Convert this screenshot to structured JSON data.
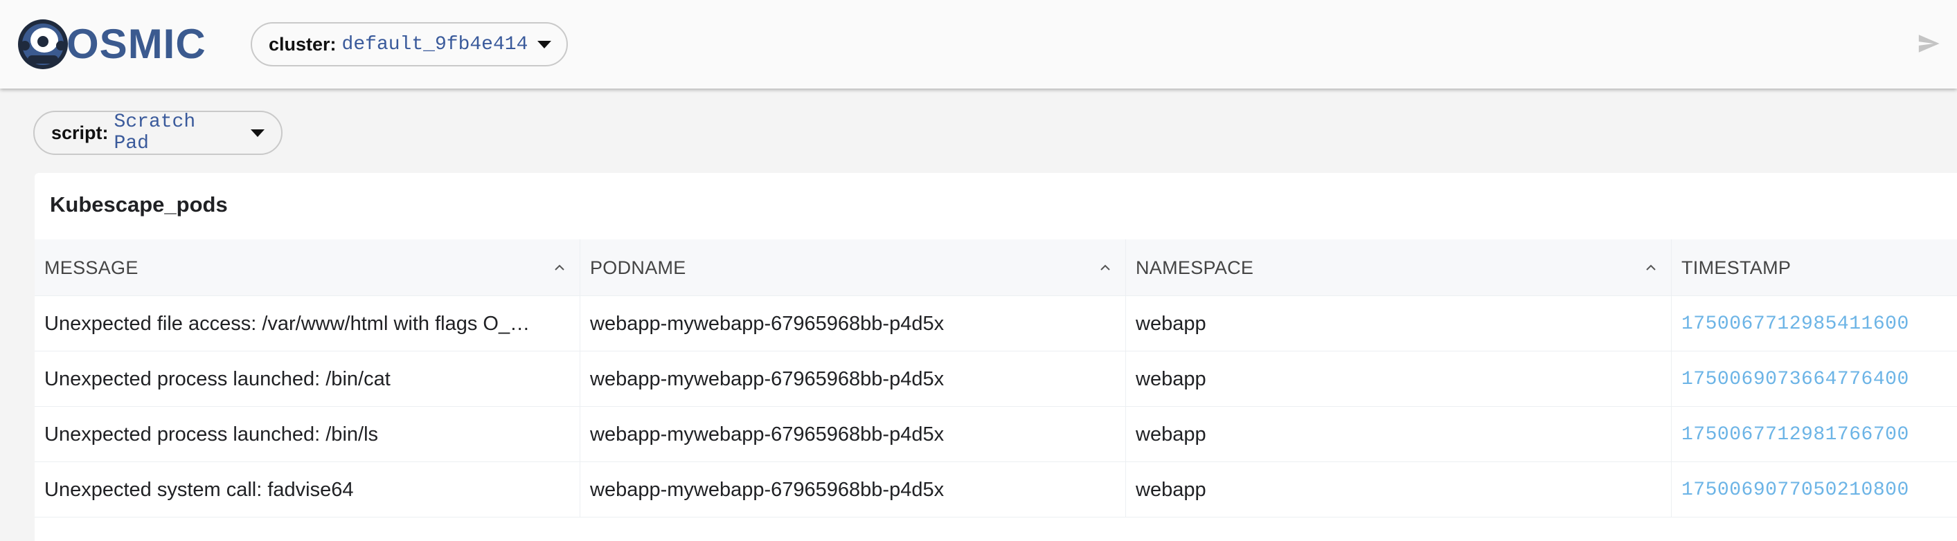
{
  "app": {
    "logo_text": "OSMIC",
    "logo_icon": "astronaut-helmet-icon"
  },
  "cluster": {
    "label": "cluster:",
    "value": "default_9fb4e414"
  },
  "header_actions": {
    "run_icon": "send-icon"
  },
  "script": {
    "label": "script:",
    "value": "Scratch Pad"
  },
  "table": {
    "title": "Kubescape_pods",
    "columns": [
      {
        "label": "MESSAGE",
        "sortable": true
      },
      {
        "label": "PODNAME",
        "sortable": true
      },
      {
        "label": "NAMESPACE",
        "sortable": true
      },
      {
        "label": "TIMESTAMP",
        "sortable": false
      }
    ],
    "rows": [
      {
        "message": "Unexpected file access: /var/www/html with flags O_…",
        "podname": "webapp-mywebapp-67965968bb-p4d5x",
        "namespace": "webapp",
        "timestamp": "1750067712985411600"
      },
      {
        "message": "Unexpected process launched: /bin/cat",
        "podname": "webapp-mywebapp-67965968bb-p4d5x",
        "namespace": "webapp",
        "timestamp": "1750069073664776400"
      },
      {
        "message": "Unexpected process launched: /bin/ls",
        "podname": "webapp-mywebapp-67965968bb-p4d5x",
        "namespace": "webapp",
        "timestamp": "1750067712981766700"
      },
      {
        "message": "Unexpected system call: fadvise64",
        "podname": "webapp-mywebapp-67965968bb-p4d5x",
        "namespace": "webapp",
        "timestamp": "1750069077050210800"
      }
    ]
  },
  "colors": {
    "brand": "#3b5a8f",
    "timestamp_link": "#6cb4e6",
    "selector_value": "#3a5a9b"
  }
}
